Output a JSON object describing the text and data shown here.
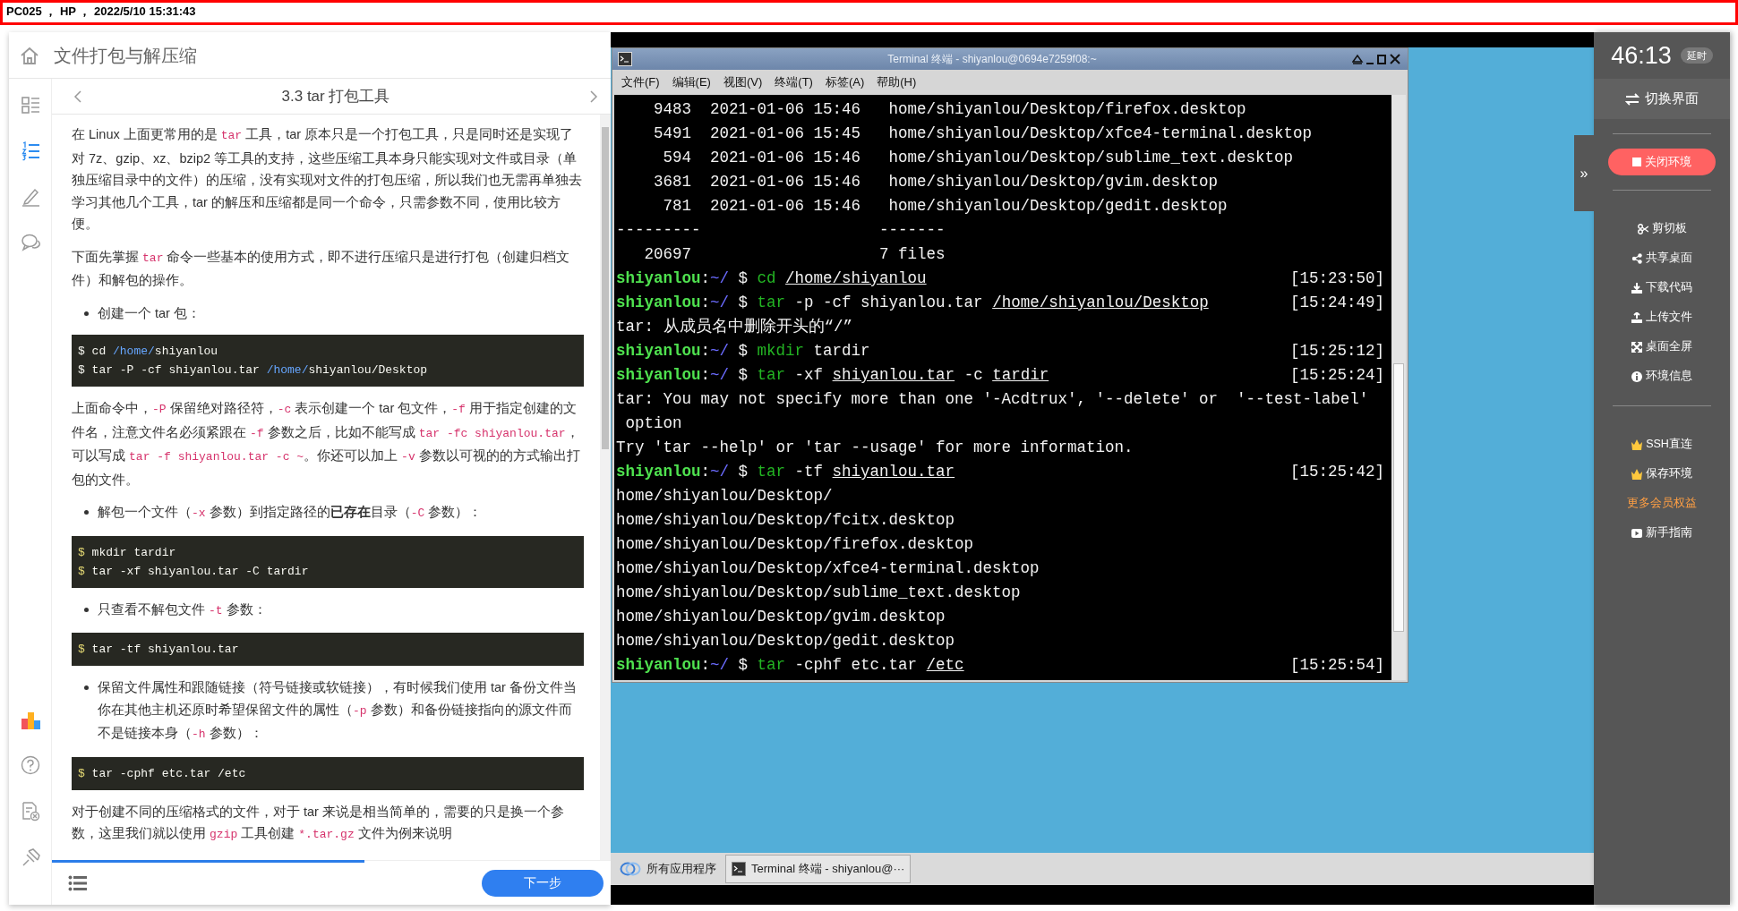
{
  "top_bar": {
    "text": "PC025 ， HP ， 2022/5/10 15:31:43"
  },
  "lesson": {
    "course_title": "文件打包与解压缩",
    "rail": [
      {
        "kind": "catalog",
        "selected": false
      },
      {
        "kind": "steps",
        "selected": true
      },
      {
        "kind": "notes",
        "selected": false
      },
      {
        "kind": "comments",
        "selected": false
      },
      {
        "kind": "ranking",
        "selected": false
      },
      {
        "kind": "help",
        "selected": false
      },
      {
        "kind": "report",
        "selected": false
      },
      {
        "kind": "pin",
        "selected": false
      }
    ],
    "section_title": "3.3 tar 打包工具",
    "blocks": [
      {
        "kind": "paragraph",
        "parts": [
          {
            "text": "在 Linux 上面更常用的是 ",
            "kind": "text"
          },
          {
            "text": "tar",
            "kind": "code"
          },
          {
            "text": " 工具，tar 原本只是一个打包工具，只是同时还是实现了对 7z、gzip、xz、bzip2 等工具的支持，这些压缩工具本身只能实现对文件或目录（单独压缩目录中的文件）的压缩，没有实现对文件的打包压缩，所以我们也无需再单独去学习其他几个工具，tar 的解压和压缩都是同一个命令，只需参数不同，使用比较方便。",
            "kind": "text"
          }
        ]
      },
      {
        "kind": "paragraph",
        "parts": [
          {
            "text": "下面先掌握 ",
            "kind": "text"
          },
          {
            "text": "tar",
            "kind": "code"
          },
          {
            "text": " 命令一些基本的使用方式，即不进行压缩只是进行打包（创建归档文件）和解包的操作。",
            "kind": "text"
          }
        ]
      },
      {
        "kind": "bullet",
        "parts": [
          {
            "text": "创建一个 tar 包：",
            "kind": "text"
          }
        ]
      },
      {
        "kind": "code",
        "lines": [
          [
            {
              "text": "$ cd ",
              "kind": "plain"
            },
            {
              "text": "/home/",
              "kind": "path"
            },
            {
              "text": "shiyanlou",
              "kind": "plain"
            }
          ],
          [
            {
              "text": "$ tar -P -cf shiyanlou.tar ",
              "kind": "plain"
            },
            {
              "text": "/home/",
              "kind": "path"
            },
            {
              "text": "shiyanlou/Desktop",
              "kind": "plain"
            }
          ]
        ]
      },
      {
        "kind": "paragraph",
        "parts": [
          {
            "text": "上面命令中，",
            "kind": "text"
          },
          {
            "text": "-P",
            "kind": "code"
          },
          {
            "text": " 保留绝对路径符，",
            "kind": "text"
          },
          {
            "text": "-c",
            "kind": "code"
          },
          {
            "text": " 表示创建一个 tar 包文件，",
            "kind": "text"
          },
          {
            "text": "-f",
            "kind": "code"
          },
          {
            "text": " 用于指定创建的文件名，注意文件名必须紧跟在 ",
            "kind": "text"
          },
          {
            "text": "-f",
            "kind": "code"
          },
          {
            "text": " 参数之后，比如不能写成 ",
            "kind": "text"
          },
          {
            "text": "tar -fc shiyanlou.tar",
            "kind": "code"
          },
          {
            "text": "，可以写成 ",
            "kind": "text"
          },
          {
            "text": "tar -f shiyanlou.tar -c ~",
            "kind": "code"
          },
          {
            "text": "。你还可以加上 ",
            "kind": "text"
          },
          {
            "text": "-v",
            "kind": "code"
          },
          {
            "text": " 参数以可视的的方式输出打包的文件。",
            "kind": "text"
          }
        ]
      },
      {
        "kind": "bullet",
        "parts": [
          {
            "text": "解包一个文件（",
            "kind": "text"
          },
          {
            "text": "-x",
            "kind": "code"
          },
          {
            "text": " 参数）到指定路径的**已存在**目录（",
            "kind": "text"
          },
          {
            "text": "-C",
            "kind": "code"
          },
          {
            "text": " 参数）：",
            "kind": "text"
          }
        ]
      },
      {
        "kind": "code",
        "lines": [
          [
            {
              "text": "$",
              "kind": "prompt"
            },
            {
              "text": " mkdir tardir",
              "kind": "plain"
            }
          ],
          [
            {
              "text": "$",
              "kind": "prompt"
            },
            {
              "text": " tar -xf shiyanlou.tar -C tardir",
              "kind": "plain"
            }
          ]
        ]
      },
      {
        "kind": "bullet",
        "parts": [
          {
            "text": "只查看不解包文件 ",
            "kind": "text"
          },
          {
            "text": "-t",
            "kind": "code"
          },
          {
            "text": " 参数：",
            "kind": "text"
          }
        ]
      },
      {
        "kind": "code",
        "lines": [
          [
            {
              "text": "$",
              "kind": "prompt"
            },
            {
              "text": " tar -tf shiyanlou.tar",
              "kind": "plain"
            }
          ]
        ]
      },
      {
        "kind": "bullet",
        "parts": [
          {
            "text": "保留文件属性和跟随链接（符号链接或软链接），有时候我们使用 tar 备份文件当你在其他主机还原时希望保留文件的属性（",
            "kind": "text"
          },
          {
            "text": "-p",
            "kind": "code"
          },
          {
            "text": " 参数）和备份链接指向的源文件而不是链接本身（",
            "kind": "text"
          },
          {
            "text": "-h",
            "kind": "code"
          },
          {
            "text": " 参数）：",
            "kind": "text"
          }
        ]
      },
      {
        "kind": "code",
        "lines": [
          [
            {
              "text": "$",
              "kind": "prompt"
            },
            {
              "text": " tar -cphf etc.tar /etc",
              "kind": "plain"
            }
          ]
        ]
      },
      {
        "kind": "paragraph",
        "parts": [
          {
            "text": "对于创建不同的压缩格式的文件，对于 tar 来说是相当简单的，需要的只是换一个参数，这里我们就以使用 ",
            "kind": "text"
          },
          {
            "text": "gzip",
            "kind": "code"
          },
          {
            "text": " 工具创建 ",
            "kind": "text"
          },
          {
            "text": "*.tar.gz",
            "kind": "code"
          },
          {
            "text": " 文件为例来说明",
            "kind": "text"
          }
        ]
      }
    ],
    "progress": {
      "level": 0.56
    },
    "next_button": "下一步"
  },
  "desktop": {
    "terminal": {
      "title": "Terminal 终端 - shiyanlou@0694e7259f08:~",
      "menu": [
        "文件(F)",
        "编辑(E)",
        "视图(V)",
        "终端(T)",
        "标签(A)",
        "帮助(H)"
      ],
      "lines": [
        {
          "segments": [
            {
              "text": "    9483  2021-01-06 15:46   home/shiyanlou/Desktop/firefox.desktop",
              "kind": "plain"
            }
          ]
        },
        {
          "segments": [
            {
              "text": "    5491  2021-01-06 15:45   home/shiyanlou/Desktop/xfce4-terminal.desktop",
              "kind": "plain"
            }
          ]
        },
        {
          "segments": [
            {
              "text": "     594  2021-01-06 15:46   home/shiyanlou/Desktop/sublime_text.desktop",
              "kind": "plain"
            }
          ]
        },
        {
          "segments": [
            {
              "text": "    3681  2021-01-06 15:46   home/shiyanlou/Desktop/gvim.desktop",
              "kind": "plain"
            }
          ]
        },
        {
          "segments": [
            {
              "text": "     781  2021-01-06 15:46   home/shiyanlou/Desktop/gedit.desktop",
              "kind": "plain"
            }
          ]
        },
        {
          "segments": [
            {
              "text": "---------                   -------",
              "kind": "plain"
            }
          ]
        },
        {
          "segments": [
            {
              "text": "   20697                    7 files",
              "kind": "plain"
            }
          ]
        },
        {
          "segments": [
            {
              "text": "shiyanlou",
              "kind": "user"
            },
            {
              "text": ":",
              "kind": "plain"
            },
            {
              "text": "~/",
              "kind": "tilde"
            },
            {
              "text": " $ ",
              "kind": "plain"
            },
            {
              "text": "cd ",
              "kind": "command"
            },
            {
              "text": "/home/shiyanlou",
              "kind": "underline"
            }
          ],
          "time": "[15:23:50]"
        },
        {
          "segments": [
            {
              "text": "shiyanlou",
              "kind": "user"
            },
            {
              "text": ":",
              "kind": "plain"
            },
            {
              "text": "~/",
              "kind": "tilde"
            },
            {
              "text": " $ ",
              "kind": "plain"
            },
            {
              "text": "tar ",
              "kind": "command"
            },
            {
              "text": "-p -cf shiyanlou.tar ",
              "kind": "plain"
            },
            {
              "text": "/home/shiyanlou/Desktop",
              "kind": "underline"
            }
          ],
          "time": "[15:24:49]"
        },
        {
          "segments": [
            {
              "text": "tar: 从成员名中删除开头的“/”",
              "kind": "plain"
            }
          ]
        },
        {
          "segments": [
            {
              "text": "shiyanlou",
              "kind": "user"
            },
            {
              "text": ":",
              "kind": "plain"
            },
            {
              "text": "~/",
              "kind": "tilde"
            },
            {
              "text": " $ ",
              "kind": "plain"
            },
            {
              "text": "mkdir ",
              "kind": "command"
            },
            {
              "text": "tardir",
              "kind": "plain"
            }
          ],
          "time": "[15:25:12]"
        },
        {
          "segments": [
            {
              "text": "shiyanlou",
              "kind": "user"
            },
            {
              "text": ":",
              "kind": "plain"
            },
            {
              "text": "~/",
              "kind": "tilde"
            },
            {
              "text": " $ ",
              "kind": "plain"
            },
            {
              "text": "tar ",
              "kind": "command"
            },
            {
              "text": "-xf ",
              "kind": "plain"
            },
            {
              "text": "shiyanlou.tar",
              "kind": "underline"
            },
            {
              "text": " -c ",
              "kind": "plain"
            },
            {
              "text": "tardir",
              "kind": "underline"
            }
          ],
          "time": "[15:25:24]"
        },
        {
          "segments": [
            {
              "text": "tar: You may not specify more than one '-Acdtrux', '--delete' or  '--test-label'",
              "kind": "plain"
            }
          ]
        },
        {
          "segments": [
            {
              "text": " option",
              "kind": "plain"
            }
          ]
        },
        {
          "segments": [
            {
              "text": "Try 'tar --help' or 'tar --usage' for more information.",
              "kind": "plain"
            }
          ]
        },
        {
          "segments": [
            {
              "text": "shiyanlou",
              "kind": "user"
            },
            {
              "text": ":",
              "kind": "plain"
            },
            {
              "text": "~/",
              "kind": "tilde"
            },
            {
              "text": " $ ",
              "kind": "plain"
            },
            {
              "text": "tar ",
              "kind": "command"
            },
            {
              "text": "-tf ",
              "kind": "plain"
            },
            {
              "text": "shiyanlou.tar",
              "kind": "underline"
            }
          ],
          "time": "[15:25:42]"
        },
        {
          "segments": [
            {
              "text": "home/shiyanlou/Desktop/",
              "kind": "plain"
            }
          ]
        },
        {
          "segments": [
            {
              "text": "home/shiyanlou/Desktop/fcitx.desktop",
              "kind": "plain"
            }
          ]
        },
        {
          "segments": [
            {
              "text": "home/shiyanlou/Desktop/firefox.desktop",
              "kind": "plain"
            }
          ]
        },
        {
          "segments": [
            {
              "text": "home/shiyanlou/Desktop/xfce4-terminal.desktop",
              "kind": "plain"
            }
          ]
        },
        {
          "segments": [
            {
              "text": "home/shiyanlou/Desktop/sublime_text.desktop",
              "kind": "plain"
            }
          ]
        },
        {
          "segments": [
            {
              "text": "home/shiyanlou/Desktop/gvim.desktop",
              "kind": "plain"
            }
          ]
        },
        {
          "segments": [
            {
              "text": "home/shiyanlou/Desktop/gedit.desktop",
              "kind": "plain"
            }
          ]
        },
        {
          "segments": [
            {
              "text": "shiyanlou",
              "kind": "user"
            },
            {
              "text": ":",
              "kind": "plain"
            },
            {
              "text": "~/",
              "kind": "tilde"
            },
            {
              "text": " $ ",
              "kind": "plain"
            },
            {
              "text": "tar ",
              "kind": "command"
            },
            {
              "text": "-cphf etc.tar ",
              "kind": "plain"
            },
            {
              "text": "/etc",
              "kind": "underline"
            }
          ],
          "time": "[15:25:54]"
        }
      ]
    },
    "taskbar": [
      {
        "kind": "apps",
        "label": "所有应用程序"
      },
      {
        "kind": "window",
        "label": "Terminal 终端 - shiyanlou@···"
      }
    ]
  },
  "sidebar": {
    "expand_tab": "»",
    "timer": "46:13",
    "extend_badge": "延时",
    "switch_button": "切换界面",
    "close_button": "关闭环境",
    "tools": [
      {
        "kind": "clipboard",
        "label": "剪切板"
      },
      {
        "kind": "share",
        "label": "共享桌面"
      },
      {
        "kind": "download",
        "label": "下载代码"
      },
      {
        "kind": "upload",
        "label": "上传文件"
      },
      {
        "kind": "fullscreen",
        "label": "桌面全屏"
      },
      {
        "kind": "info",
        "label": "环境信息"
      }
    ],
    "extras": [
      {
        "kind": "premium",
        "label": "SSH直连"
      },
      {
        "kind": "premium",
        "label": "保存环境"
      },
      {
        "kind": "link",
        "label": "更多会员权益"
      },
      {
        "kind": "guide",
        "label": "新手指南"
      }
    ]
  }
}
